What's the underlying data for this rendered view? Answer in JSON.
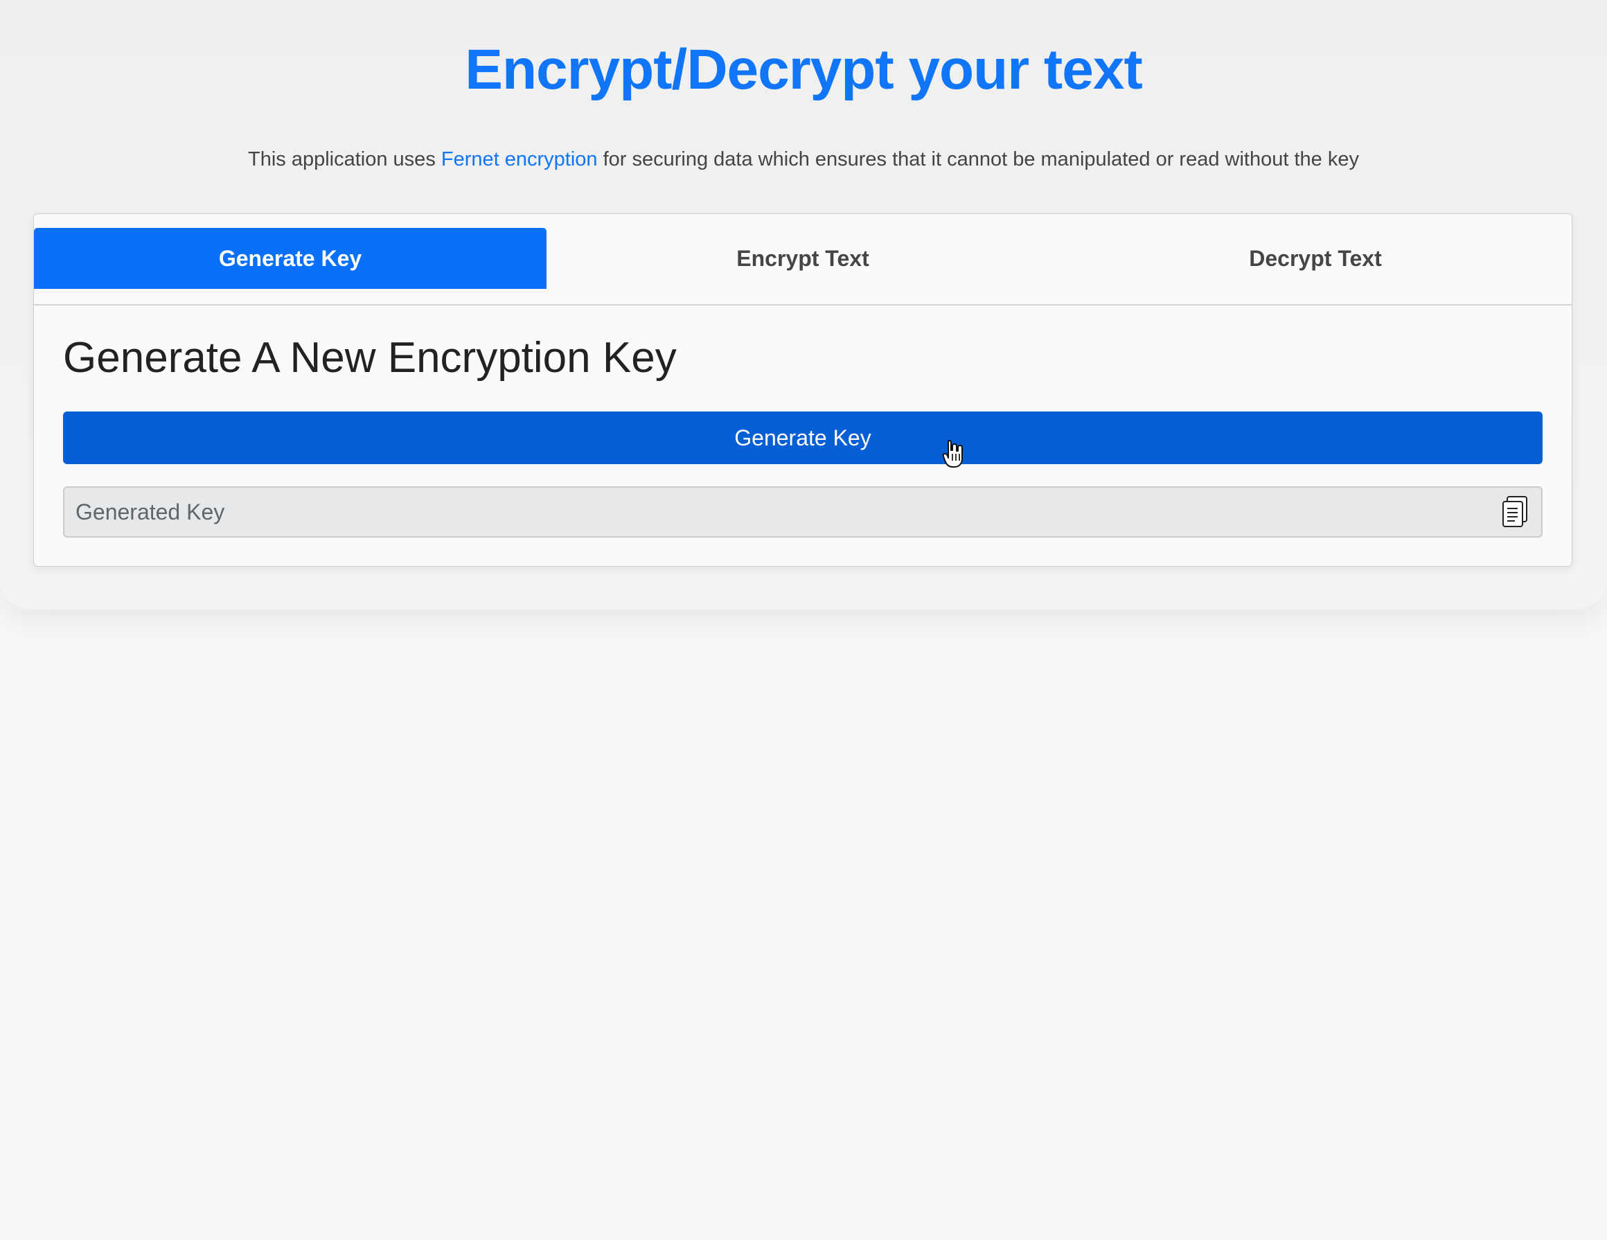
{
  "header": {
    "title": "Encrypt/Decrypt your text",
    "subtitle_before": "This application uses ",
    "subtitle_link": "Fernet encryption",
    "subtitle_after": " for securing data which ensures that it cannot be manipulated or read without the key"
  },
  "tabs": [
    {
      "label": "Generate Key",
      "active": true
    },
    {
      "label": "Encrypt Text",
      "active": false
    },
    {
      "label": "Decrypt Text",
      "active": false
    }
  ],
  "generate_panel": {
    "title": "Generate A New Encryption Key",
    "button_label": "Generate Key",
    "key_placeholder": "Generated Key",
    "key_value": ""
  },
  "colors": {
    "accent": "#0a70f7",
    "button": "#065fd4",
    "text": "#222222",
    "field_bg": "#e7e8ea"
  },
  "icons": {
    "copy": "copy-icon",
    "cursor": "hand-pointer-icon"
  }
}
